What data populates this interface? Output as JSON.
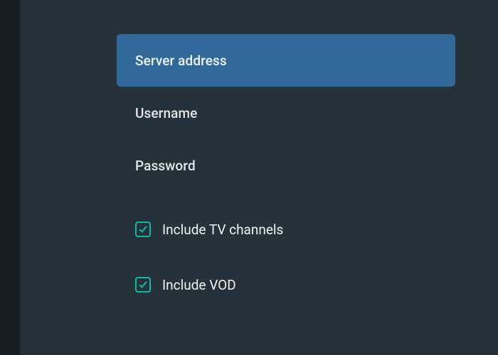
{
  "form": {
    "items": [
      {
        "label": "Server address",
        "selected": true
      },
      {
        "label": "Username",
        "selected": false
      },
      {
        "label": "Password",
        "selected": false
      }
    ],
    "options": [
      {
        "label": "Include TV channels",
        "checked": true
      },
      {
        "label": "Include VOD",
        "checked": true
      }
    ]
  }
}
